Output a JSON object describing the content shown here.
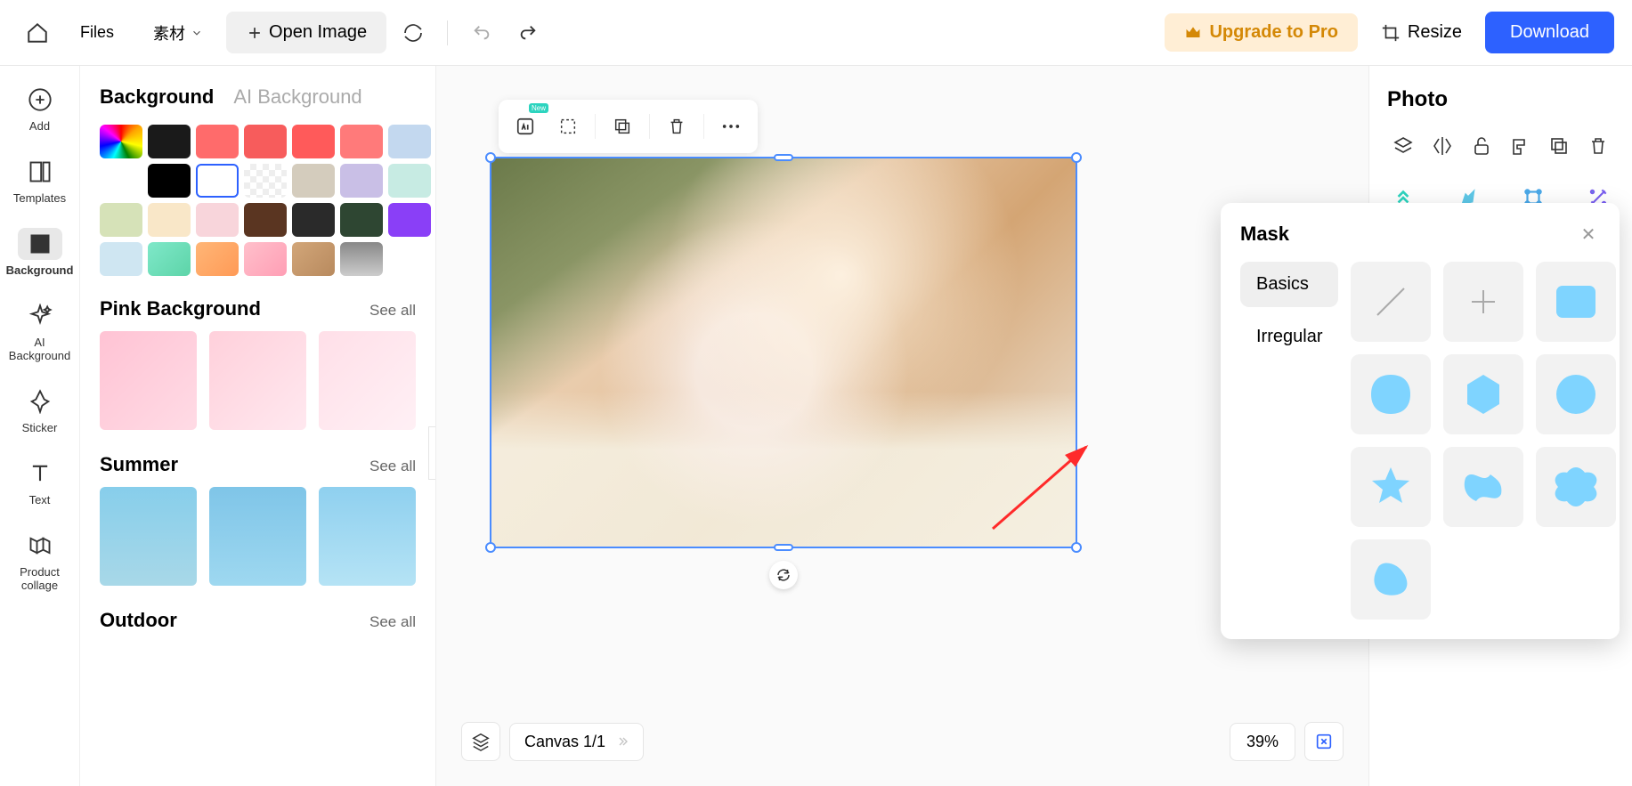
{
  "topbar": {
    "files": "Files",
    "materials": "素材",
    "open_image": "Open Image",
    "upgrade": "Upgrade to Pro",
    "resize": "Resize",
    "download": "Download"
  },
  "left_rail": {
    "add": "Add",
    "templates": "Templates",
    "background": "Background",
    "ai_background": "AI Background",
    "sticker": "Sticker",
    "text": "Text",
    "product_collage": "Product collage"
  },
  "panel": {
    "tab_background": "Background",
    "tab_ai": "AI Background",
    "swatches": [
      {
        "c": "rainbow"
      },
      {
        "c": "#1a1a1a"
      },
      {
        "c": "#ff6b6b"
      },
      {
        "c": "#f75c5c"
      },
      {
        "c": "#ff5a5a"
      },
      {
        "c": "#ff7a7a"
      },
      {
        "c": "#c3d8ef"
      },
      {
        "c": "#ffffff"
      },
      {
        "c": "#000000"
      },
      {
        "c": "selected"
      },
      {
        "c": "transparent"
      },
      {
        "c": "#d4ccbd"
      },
      {
        "c": "#c9bfe6"
      },
      {
        "c": "#c7ebe3"
      },
      {
        "c": "#d6e2b8"
      },
      {
        "c": "#f9e7c8"
      },
      {
        "c": "#f8d5db"
      },
      {
        "c": "#5a3521"
      },
      {
        "c": "#2a2a2a"
      },
      {
        "c": "#2e4632"
      },
      {
        "c": "#8a3ff7"
      },
      {
        "c": "#cfe6f2"
      },
      {
        "c": "linear-gradient(135deg,#7fe8c9,#5dd4a8)"
      },
      {
        "c": "linear-gradient(135deg,#ffb677,#ff9a56)"
      },
      {
        "c": "linear-gradient(135deg,#ffc0cb,#ff9eb5)"
      },
      {
        "c": "linear-gradient(135deg,#d2a679,#b88a5e)"
      },
      {
        "c": "linear-gradient(180deg,#888,#ccc)"
      }
    ],
    "sections": [
      {
        "title": "Pink Background",
        "see_all": "See all",
        "thumbs": [
          "linear-gradient(135deg,#ffc3d4,#ffdbe5)",
          "linear-gradient(135deg,#ffd0db,#ffe8ef)",
          "linear-gradient(135deg,#ffdfe8,#fff0f5)"
        ]
      },
      {
        "title": "Summer",
        "see_all": "See all",
        "thumbs": [
          "linear-gradient(180deg,#87ceeb,#a8d8e8)",
          "linear-gradient(180deg,#7fc5e8,#9ed8f0)",
          "linear-gradient(180deg,#8fd0ef,#b5e3f5)"
        ]
      },
      {
        "title": "Outdoor",
        "see_all": "See all",
        "thumbs": []
      }
    ]
  },
  "canvas": {
    "label": "Canvas 1/1",
    "zoom": "39%"
  },
  "right": {
    "title": "Photo"
  },
  "mask": {
    "title": "Mask",
    "tab_basics": "Basics",
    "tab_irregular": "Irregular"
  }
}
